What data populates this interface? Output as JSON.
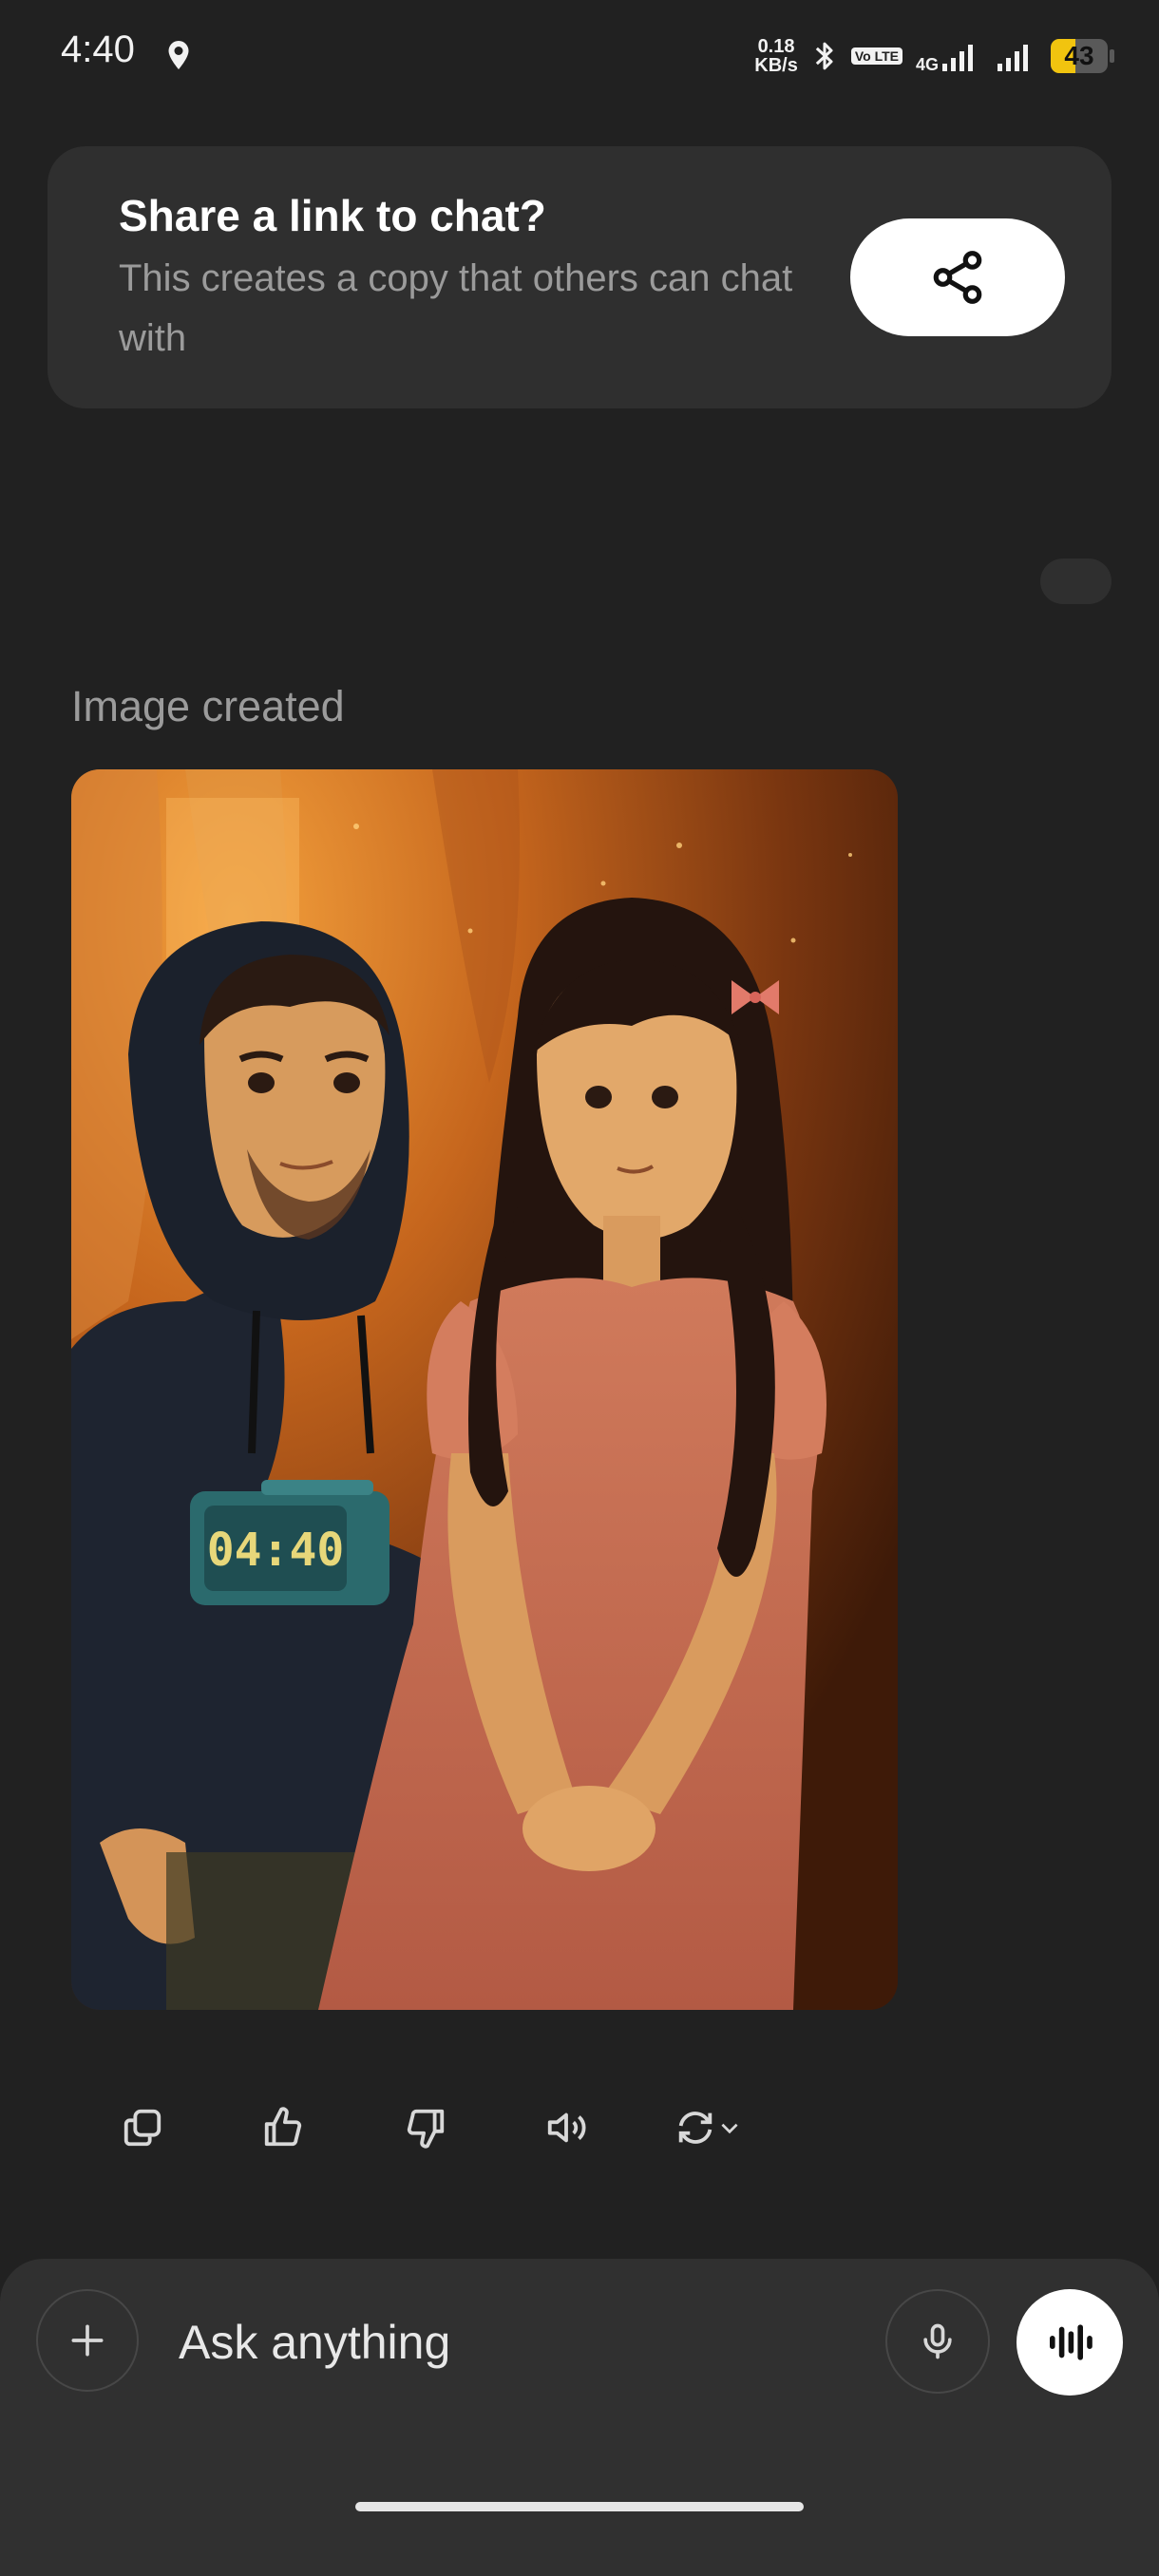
{
  "status_bar": {
    "time": "4:40",
    "speed_value": "0.18",
    "speed_unit": "KB/s",
    "volte": "Vo LTE",
    "network": "4G",
    "battery_level": "43",
    "battery_fraction": 0.43,
    "icons": [
      "location-icon",
      "bluetooth-icon",
      "signal-icon",
      "signal-icon-2",
      "battery-icon"
    ]
  },
  "share_card": {
    "title": "Share a link to chat?",
    "subtitle": "This creates a copy that others can chat with",
    "button_icon": "share-icon"
  },
  "message": {
    "label": "Image created",
    "image_clock_text": "04:40"
  },
  "actions": {
    "icons": [
      "copy-icon",
      "thumbs-up-icon",
      "thumbs-down-icon",
      "speaker-icon",
      "regenerate-icon",
      "chevron-down-icon"
    ]
  },
  "composer": {
    "placeholder": "Ask anything",
    "icons": [
      "plus-icon",
      "mic-icon",
      "voice-wave-icon"
    ]
  },
  "colors": {
    "background": "#212121",
    "card": "#2f2f2f",
    "composer": "#303030",
    "muted_text": "#9b9b9b",
    "battery_accent": "#f1c40f"
  }
}
